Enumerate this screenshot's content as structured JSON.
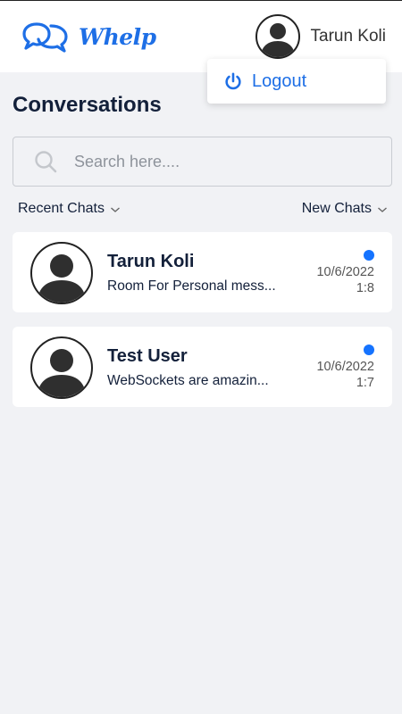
{
  "app": {
    "name": "Whelp"
  },
  "header": {
    "user_name": "Tarun Koli"
  },
  "menu": {
    "logout_label": "Logout"
  },
  "page": {
    "title": "Conversations"
  },
  "search": {
    "placeholder": "Search here....",
    "value": ""
  },
  "filters": {
    "left_label": "Recent Chats",
    "right_label": "New Chats"
  },
  "conversations": [
    {
      "name": "Tarun Koli",
      "last_message": "Room For Personal mess...",
      "date": "10/6/2022",
      "time": "1:8",
      "unread": true
    },
    {
      "name": "Test User",
      "last_message": "WebSockets are amazin...",
      "date": "10/6/2022",
      "time": "1:7",
      "unread": true
    }
  ],
  "colors": {
    "accent": "#1e6fe6",
    "unread_dot": "#1573ff",
    "background": "#f1f2f5",
    "text": "#13203a"
  },
  "icons": [
    "chat-bubbles-logo-icon",
    "avatar-icon",
    "power-icon",
    "search-icon",
    "chevron-down-icon"
  ]
}
